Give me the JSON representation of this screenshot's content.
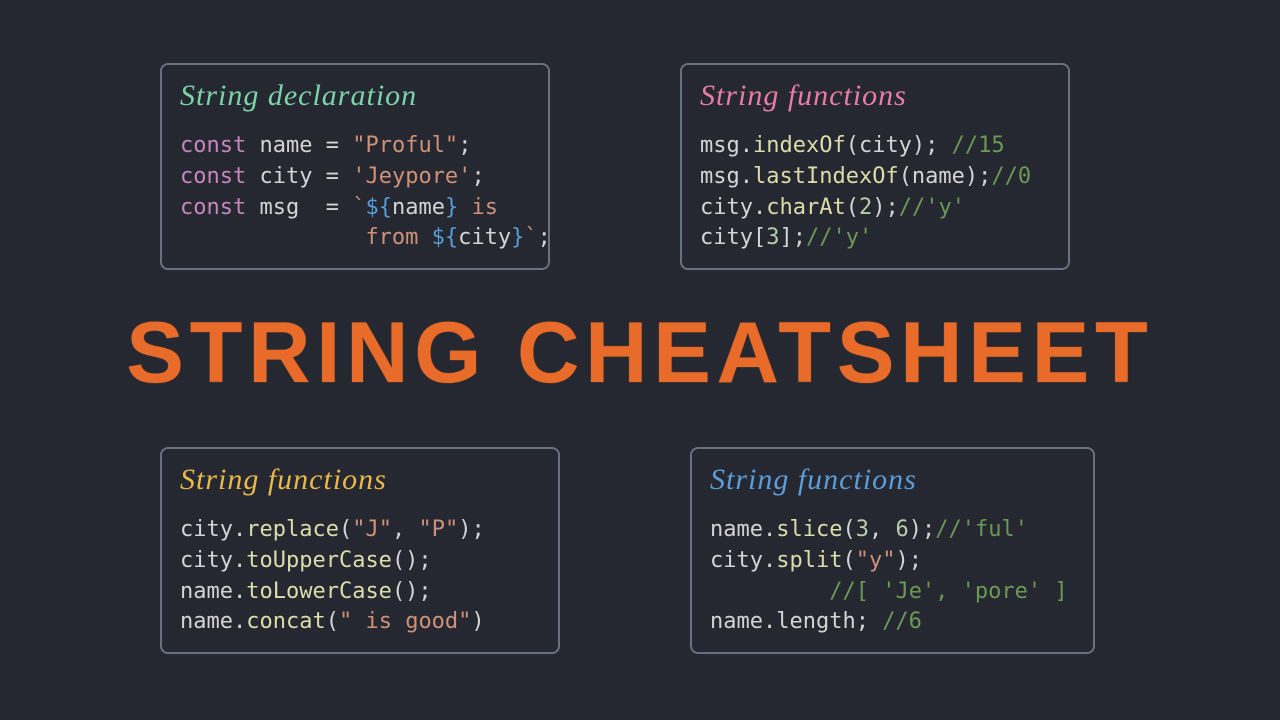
{
  "main_title": "STRING CHEATSHEET",
  "boxes": {
    "declaration": {
      "title": "String declaration",
      "lines": {
        "l1_const": "const",
        "l1_var": " name ",
        "l1_eq": "= ",
        "l1_str": "\"Proful\"",
        "l1_end": ";",
        "l2_const": "const",
        "l2_var": " city ",
        "l2_eq": "= ",
        "l2_str": "'Jeypore'",
        "l2_end": ";",
        "l3_const": "const",
        "l3_var": " msg  ",
        "l3_eq": "= ",
        "l3_bt1": "`",
        "l3_tp1": "${",
        "l3_v1": "name",
        "l3_tp1c": "}",
        "l3_txt1": " is",
        "l4_pad": "              ",
        "l4_txt": "from ",
        "l4_tp2": "${",
        "l4_v2": "city",
        "l4_tp2c": "}",
        "l4_bt2": "`",
        "l4_end": ";"
      }
    },
    "functions_tr": {
      "title": "String functions",
      "l1_a": "msg.",
      "l1_fn": "indexOf",
      "l1_b": "(city); ",
      "l1_c": "//15",
      "l2_a": "msg.",
      "l2_fn": "lastIndexOf",
      "l2_b": "(name);",
      "l2_c": "//0",
      "l3_a": "city.",
      "l3_fn": "charAt",
      "l3_b": "(",
      "l3_n": "2",
      "l3_c": ");",
      "l3_d": "//'y'",
      "l4_a": "city[",
      "l4_n": "3",
      "l4_b": "];",
      "l4_c": "//'y'"
    },
    "functions_bl": {
      "title": "String functions",
      "l1_a": "city.",
      "l1_fn": "replace",
      "l1_b": "(",
      "l1_s1": "\"J\"",
      "l1_c": ", ",
      "l1_s2": "\"P\"",
      "l1_d": ");",
      "l2_a": "city.",
      "l2_fn": "toUpperCase",
      "l2_b": "();",
      "l3_a": "name.",
      "l3_fn": "toLowerCase",
      "l3_b": "();",
      "l4_a": "name.",
      "l4_fn": "concat",
      "l4_b": "(",
      "l4_s": "\" is good\"",
      "l4_c": ")"
    },
    "functions_br": {
      "title": "String functions",
      "l1_a": "name.",
      "l1_fn": "slice",
      "l1_b": "(",
      "l1_n1": "3",
      "l1_c": ", ",
      "l1_n2": "6",
      "l1_d": ");",
      "l1_e": "//'ful'",
      "l2_a": "city.",
      "l2_fn": "split",
      "l2_b": "(",
      "l2_s": "\"y\"",
      "l2_c": ");",
      "l3_pad": "         ",
      "l3_c": "//[ 'Je', 'pore' ]",
      "l4_a": "name.length; ",
      "l4_c": "//6"
    }
  }
}
